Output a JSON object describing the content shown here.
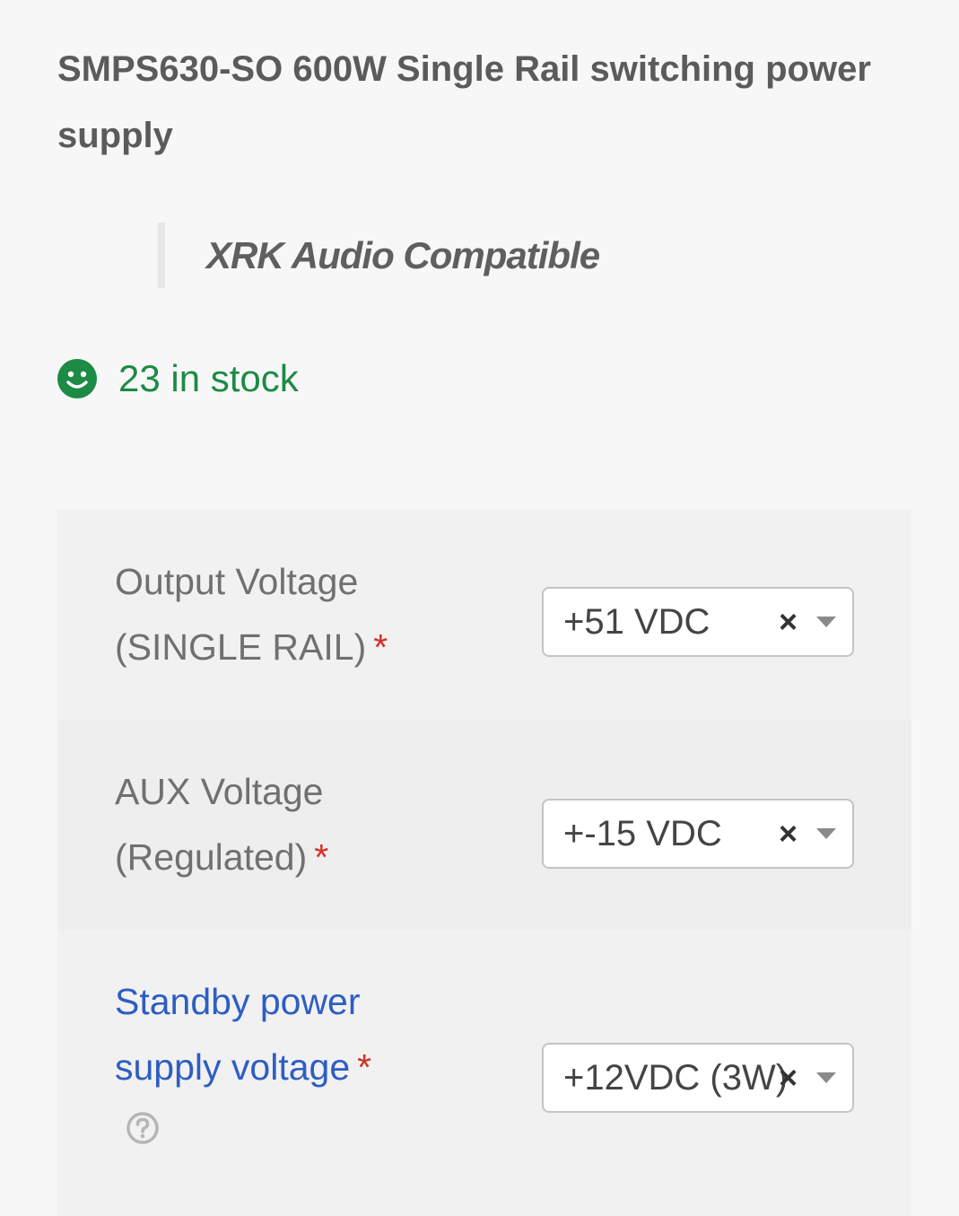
{
  "product": {
    "title": "SMPS630-SO 600W Single Rail switching power supply",
    "quote": "XRK Audio Compatible"
  },
  "stock": {
    "icon": "smile-icon",
    "text": "23 in stock",
    "color": "#1d8a45"
  },
  "options": [
    {
      "label": "Output Voltage (SINGLE RAIL)",
      "required_mark": "*",
      "selected": "+51 VDC",
      "clear_symbol": "×"
    },
    {
      "label": "AUX Voltage (Regulated)",
      "required_mark": "*",
      "selected": "+-15 VDC",
      "clear_symbol": "×"
    },
    {
      "label": "Standby power supply voltage",
      "required_mark": "*",
      "selected": "+12VDC (3W)",
      "clear_symbol": "×",
      "help_icon": "question-circle-icon",
      "label_color": "#2e5dc2"
    }
  ]
}
